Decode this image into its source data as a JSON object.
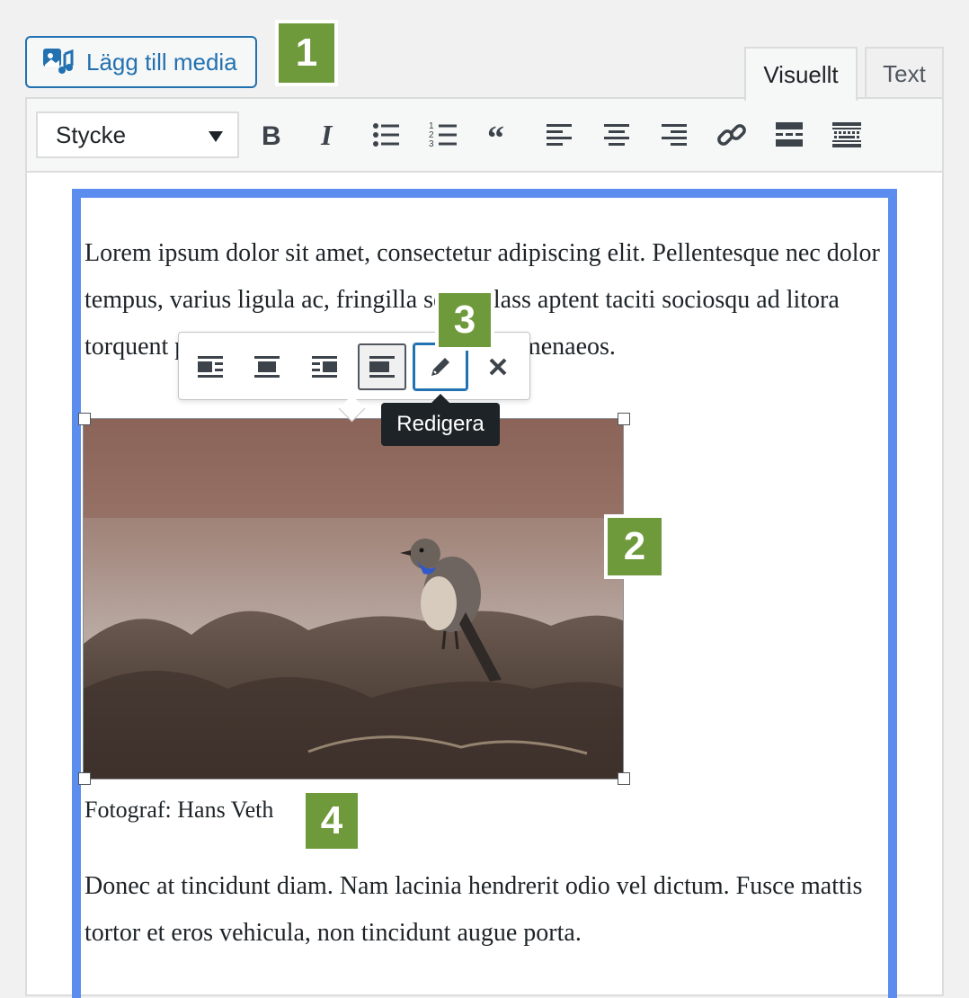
{
  "add_media": {
    "label": "Lägg till media",
    "icon": "media-add-icon"
  },
  "tabs": [
    {
      "label": "Visuellt",
      "active": true
    },
    {
      "label": "Text",
      "active": false
    }
  ],
  "toolbar": {
    "format_select": "Stycke",
    "buttons": [
      "bold-icon",
      "italic-icon",
      "bulleted-list-icon",
      "numbered-list-icon",
      "blockquote-icon",
      "align-left-icon",
      "align-center-icon",
      "align-right-icon",
      "link-icon",
      "read-more-icon",
      "toolbar-toggle-icon"
    ]
  },
  "content": {
    "paragraph1": "Lorem ipsum dolor sit amet, consectetur adipiscing elit. Pellentesque nec dolor tempus, varius ligula ac, fringilla sem. Class aptent taciti sociosqu ad litora torquent per conubia nostra, per inceptos himenaeos.",
    "caption": "Fotograf: Hans Veth",
    "paragraph2": "Donec at tincidunt diam. Nam lacinia hendrerit odio vel dictum. Fusce mattis tortor et eros vehicula, non tincidunt augue porta."
  },
  "image_toolbar": {
    "buttons": [
      "align-left-icon",
      "align-center-icon",
      "align-right-icon",
      "align-none-icon",
      "edit-pencil-icon",
      "remove-x-icon"
    ],
    "tooltip": "Redigera"
  },
  "markers": [
    "1",
    "2",
    "3",
    "4"
  ],
  "colors": {
    "accent": "#2271b1",
    "highlight": "#5b8def",
    "marker": "#6f9a3b"
  }
}
